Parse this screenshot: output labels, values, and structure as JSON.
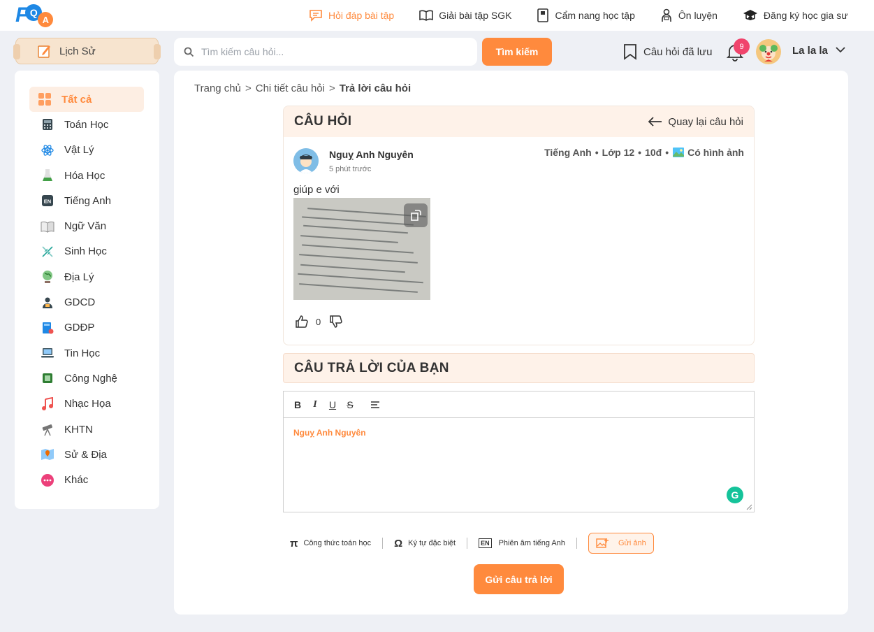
{
  "brand": {
    "logo_f": "F",
    "logo_q": "Q",
    "logo_a": "A"
  },
  "topnav": [
    {
      "label": "Hỏi đáp bài tập",
      "icon": "chat-icon",
      "active": true
    },
    {
      "label": "Giải bài tập SGK",
      "icon": "book-open-icon"
    },
    {
      "label": "Cẩm nang học tập",
      "icon": "handbook-icon"
    },
    {
      "label": "Ôn luyện",
      "icon": "student-icon"
    },
    {
      "label": "Đăng ký học gia sư",
      "icon": "graduation-cap-icon"
    }
  ],
  "subject_selector": {
    "label": "Lịch Sử"
  },
  "search": {
    "placeholder": "Tìm kiếm câu hỏi...",
    "button": "Tìm kiếm"
  },
  "saved": {
    "label": "Câu hỏi đã lưu"
  },
  "notifications": {
    "count": "9"
  },
  "user": {
    "name": "La la la"
  },
  "sidebar": {
    "items": [
      {
        "label": "Tất cả",
        "icon": "grid-icon",
        "color": "#ff8a3d"
      },
      {
        "label": "Toán Học",
        "icon": "calculator-icon",
        "color": "#37474f"
      },
      {
        "label": "Vật Lý",
        "icon": "atom-icon",
        "color": "#1e88e5"
      },
      {
        "label": "Hóa Học",
        "icon": "flask-icon",
        "color": "#43a047"
      },
      {
        "label": "Tiếng Anh",
        "icon": "en-icon",
        "color": "#37474f"
      },
      {
        "label": "Ngữ Văn",
        "icon": "book-icon",
        "color": "#8d8d8d"
      },
      {
        "label": "Sinh Học",
        "icon": "dna-icon",
        "color": "#26a69a"
      },
      {
        "label": "Địa Lý",
        "icon": "globe-icon",
        "color": "#43a047"
      },
      {
        "label": "GDCD",
        "icon": "citizen-icon",
        "color": "#37474f"
      },
      {
        "label": "GDĐP",
        "icon": "local-book-icon",
        "color": "#1e88e5"
      },
      {
        "label": "Tin Học",
        "icon": "laptop-icon",
        "color": "#455a64"
      },
      {
        "label": "Công Nghệ",
        "icon": "chip-icon",
        "color": "#2e7d32"
      },
      {
        "label": "Nhạc Họa",
        "icon": "music-icon",
        "color": "#ef5350"
      },
      {
        "label": "KHTN",
        "icon": "telescope-icon",
        "color": "#757575"
      },
      {
        "label": "Sử & Địa",
        "icon": "map-icon",
        "color": "#ef6c00"
      },
      {
        "label": "Khác",
        "icon": "more-icon",
        "color": "#ec407a"
      }
    ]
  },
  "breadcrumb": {
    "home": "Trang chủ",
    "detail": "Chi tiết câu hỏi",
    "current": "Trả lời câu hỏi",
    "sep": ">"
  },
  "question": {
    "header": "CÂU HỎI",
    "back": "Quay lại câu hỏi",
    "author": "Nguỵ Anh Nguyên",
    "time": "5 phút trước",
    "subject": "Tiếng Anh",
    "grade": "Lớp 12",
    "points": "10đ",
    "has_image": "Có hình ảnh",
    "dot": "•",
    "text": "giúp e với",
    "likes": "0"
  },
  "answer": {
    "header": "CÂU TRẢ LỜI CỦA BẠN",
    "toolbar": {
      "bold": "B",
      "italic": "I",
      "underline": "U",
      "strike": "S"
    },
    "mention": "Nguỵ Anh Nguyên"
  },
  "tools": {
    "math": {
      "symbol": "π",
      "label": "Công thức toán học"
    },
    "special": {
      "symbol": "Ω",
      "label": "Ký tự đặc biệt"
    },
    "phonetic": {
      "symbol": "EN",
      "label": "Phiên âm tiếng Anh"
    },
    "image": {
      "label": "Gửi ảnh"
    }
  },
  "submit": {
    "label": "Gửi câu trả lời"
  }
}
